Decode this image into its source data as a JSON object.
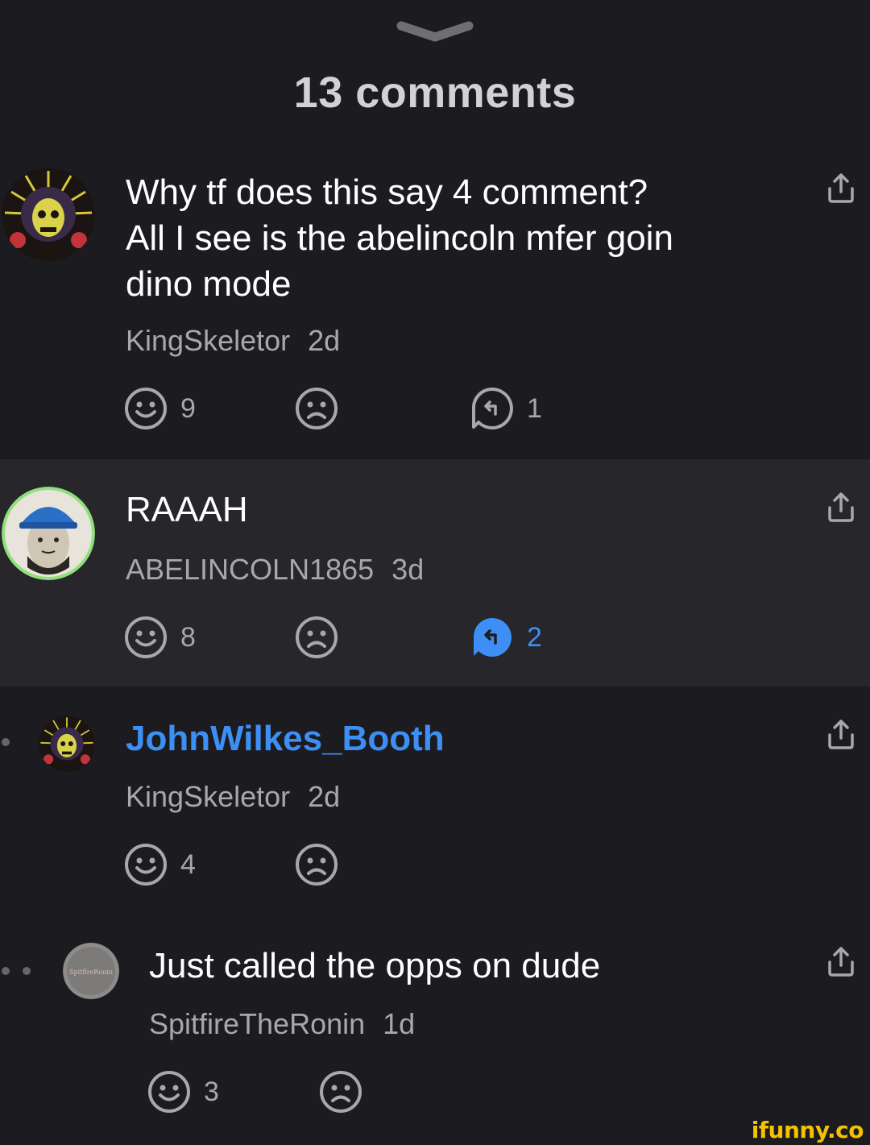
{
  "header": {
    "title": "13 comments"
  },
  "comments": [
    {
      "text_lines": [
        "Why tf does this say 4 comment?",
        "All I see is the abelincoln mfer goin",
        "dino mode"
      ],
      "author": "KingSkeletor",
      "age": "2d",
      "smiles": "9",
      "replies": "1",
      "avatar_icon": "skull-avatar"
    },
    {
      "text_lines": [
        "RAAAH"
      ],
      "author": "ABELINCOLN1865",
      "age": "3d",
      "smiles": "8",
      "replies": "2",
      "avatar_icon": "lincoln-avatar"
    },
    {
      "text_lines": [
        "JohnWilkes_Booth"
      ],
      "author": "KingSkeletor",
      "age": "2d",
      "smiles": "4",
      "avatar_icon": "skull-avatar"
    },
    {
      "text_lines": [
        "Just called the opps on dude"
      ],
      "author": "SpitfireTheRonin",
      "age": "1d",
      "smiles": "3",
      "avatar_icon": "spitfire-avatar",
      "avatar_text": "SpitfireRonin"
    }
  ],
  "watermark": "ifunny.co",
  "colors": {
    "background": "#1c1c20",
    "highlight": "#26262b",
    "accent": "#3d8ff6",
    "muted": "#a7a7ae",
    "watermark": "#f4c200"
  }
}
